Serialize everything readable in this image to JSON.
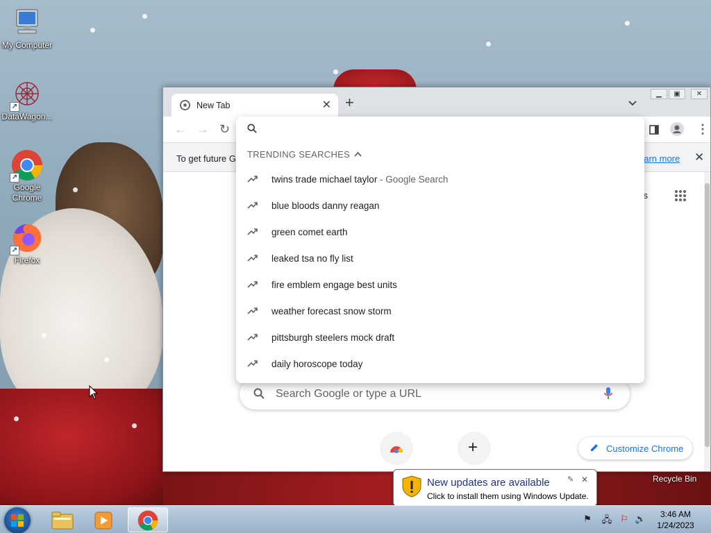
{
  "desktop": {
    "icons": [
      {
        "label": "My Computer"
      },
      {
        "label": "DataWagon..."
      },
      {
        "label": "Google Chrome"
      },
      {
        "label": "Firefox"
      }
    ],
    "recycle_bin": "Recycle Bin"
  },
  "browser": {
    "tab_title": "New Tab",
    "infobar_text": "To get future G",
    "learn_more": "earn more",
    "ntp_images_fragment": "ges",
    "search_placeholder": "Search Google or type a URL",
    "customize_label": "Customize Chrome"
  },
  "omnibox": {
    "header": "TRENDING SEARCHES",
    "suggestions": [
      {
        "text": "twins trade michael taylor",
        "sub": " - Google Search"
      },
      {
        "text": "blue bloods danny reagan",
        "sub": ""
      },
      {
        "text": "green comet earth",
        "sub": ""
      },
      {
        "text": "leaked tsa no fly list",
        "sub": ""
      },
      {
        "text": "fire emblem engage best units",
        "sub": ""
      },
      {
        "text": "weather forecast snow storm",
        "sub": ""
      },
      {
        "text": "pittsburgh steelers mock draft",
        "sub": ""
      },
      {
        "text": "daily horoscope today",
        "sub": ""
      }
    ]
  },
  "notification": {
    "title": "New updates are available",
    "body": "Click to install them using Windows Update."
  },
  "taskbar": {
    "time": "3:46 AM",
    "date": "1/24/2023"
  },
  "colors": {
    "accent": "#1a73e8",
    "balloon_title": "#1e3287"
  }
}
